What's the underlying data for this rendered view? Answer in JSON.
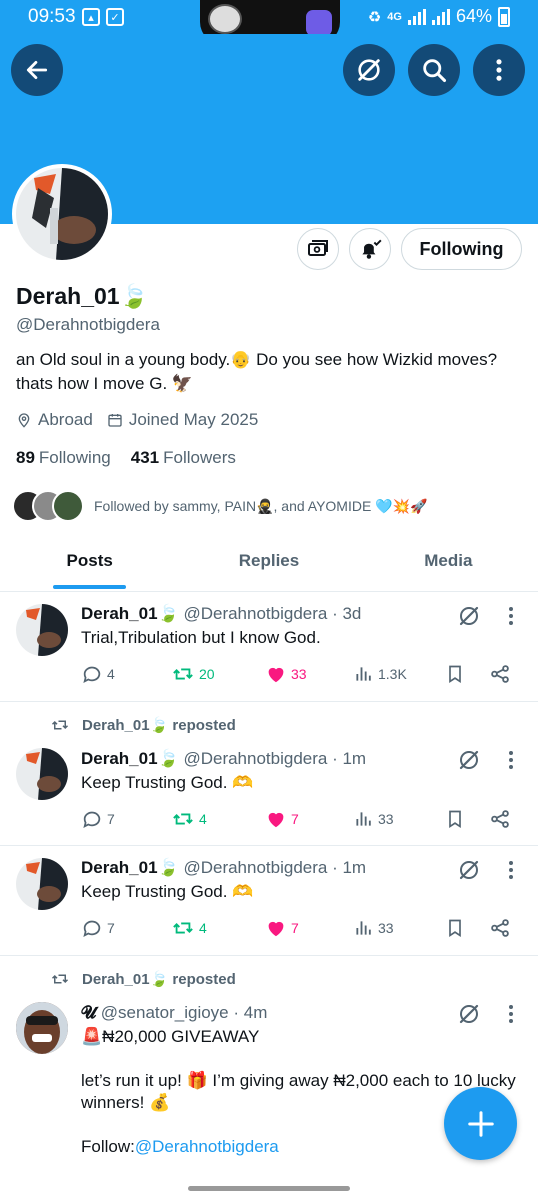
{
  "status_bar": {
    "time": "09:53",
    "battery": "64%",
    "network": "4G"
  },
  "profile": {
    "display_name": "Derah_01🍃",
    "handle": "@Derahnotbigdera",
    "bio": "an Old soul in a young body.👴 Do you see how Wizkid moves? thats how I move G. 🦅",
    "location": "Abroad",
    "joined": "Joined May 2025",
    "following_count": "89",
    "following_label": "Following",
    "followers_count": "431",
    "followers_label": "Followers",
    "followed_by": "Followed by sammy, PAIN🥷, and AYOMIDE 🩵💥🚀",
    "follow_button": "Following"
  },
  "tabs": [
    {
      "label": "Posts",
      "active": true
    },
    {
      "label": "Replies",
      "active": false
    },
    {
      "label": "Media",
      "active": false
    }
  ],
  "posts": [
    {
      "name": "Derah_01🍃",
      "handle": "@Derahnotbigdera",
      "time": "· 3d",
      "text": "Trial,Tribulation but I know God.",
      "replies": "4",
      "reposts": "20",
      "likes": "33",
      "views": "1.3K"
    },
    {
      "reposted_by": "Derah_01🍃 reposted",
      "name": "Derah_01🍃",
      "handle": "@Derahnotbigdera",
      "time": "· 1m",
      "text": "Keep Trusting God. 🫶",
      "replies": "7",
      "reposts": "4",
      "likes": "7",
      "views": "33"
    },
    {
      "name": "Derah_01🍃",
      "handle": "@Derahnotbigdera",
      "time": "· 1m",
      "text": "Keep Trusting God. 🫶",
      "replies": "7",
      "reposts": "4",
      "likes": "7",
      "views": "33"
    },
    {
      "reposted_by": "Derah_01🍃 reposted",
      "name": "𝓤",
      "handle": "@senator_igioye",
      "time": "· 4m",
      "line1": "🚨₦20,000 GIVEAWAY",
      "line2": "let’s run it up! 🎁 I’m giving away ₦2,000 each to 10 lucky winners! 💰",
      "line3_prefix": "Follow:",
      "line3_link": "@Derahnotbigdera"
    }
  ],
  "colors": {
    "accent": "#1d9bf0",
    "banner": "#1da1f2",
    "repost": "#00ba7c",
    "like": "#f91880"
  }
}
